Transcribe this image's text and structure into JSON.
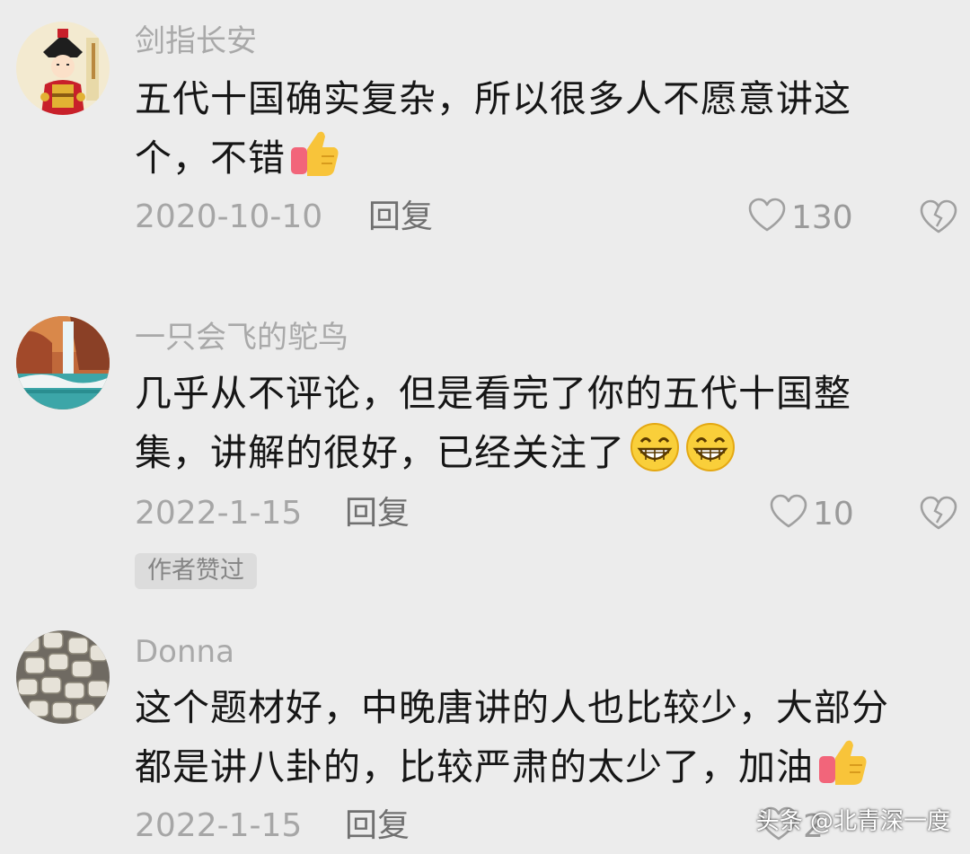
{
  "comments": [
    {
      "username": "剑指长安",
      "line1": "五代十国确实复杂，所以很多人不愿意讲这",
      "line2": "个，不错",
      "emoji_icons": [
        "thumbs-up-icon"
      ],
      "date": "2020-10-10",
      "reply_label": "回复",
      "likes": "130"
    },
    {
      "username": "一只会飞的鸵鸟",
      "line1": "几乎从不评论，但是看完了你的五代十国整",
      "line2": "集，讲解的很好，已经关注了",
      "emoji_icons": [
        "grin-icon",
        "grin-icon"
      ],
      "date": "2022-1-15",
      "reply_label": "回复",
      "likes": "10",
      "badge": "作者赞过"
    },
    {
      "username": "Donna",
      "line1": "这个题材好，中晚唐讲的人也比较少，大部分",
      "line2": "都是讲八卦的，比较严肃的太少了，加油",
      "emoji_icons": [
        "thumbs-up-icon"
      ],
      "date": "2022-1-15",
      "reply_label": "回复",
      "likes": "2"
    }
  ],
  "watermark": "头条 @北青深一度",
  "colors": {
    "background": "#ececec",
    "username": "#a9a9a9",
    "text": "#161616",
    "meta": "#a6a6a6"
  }
}
